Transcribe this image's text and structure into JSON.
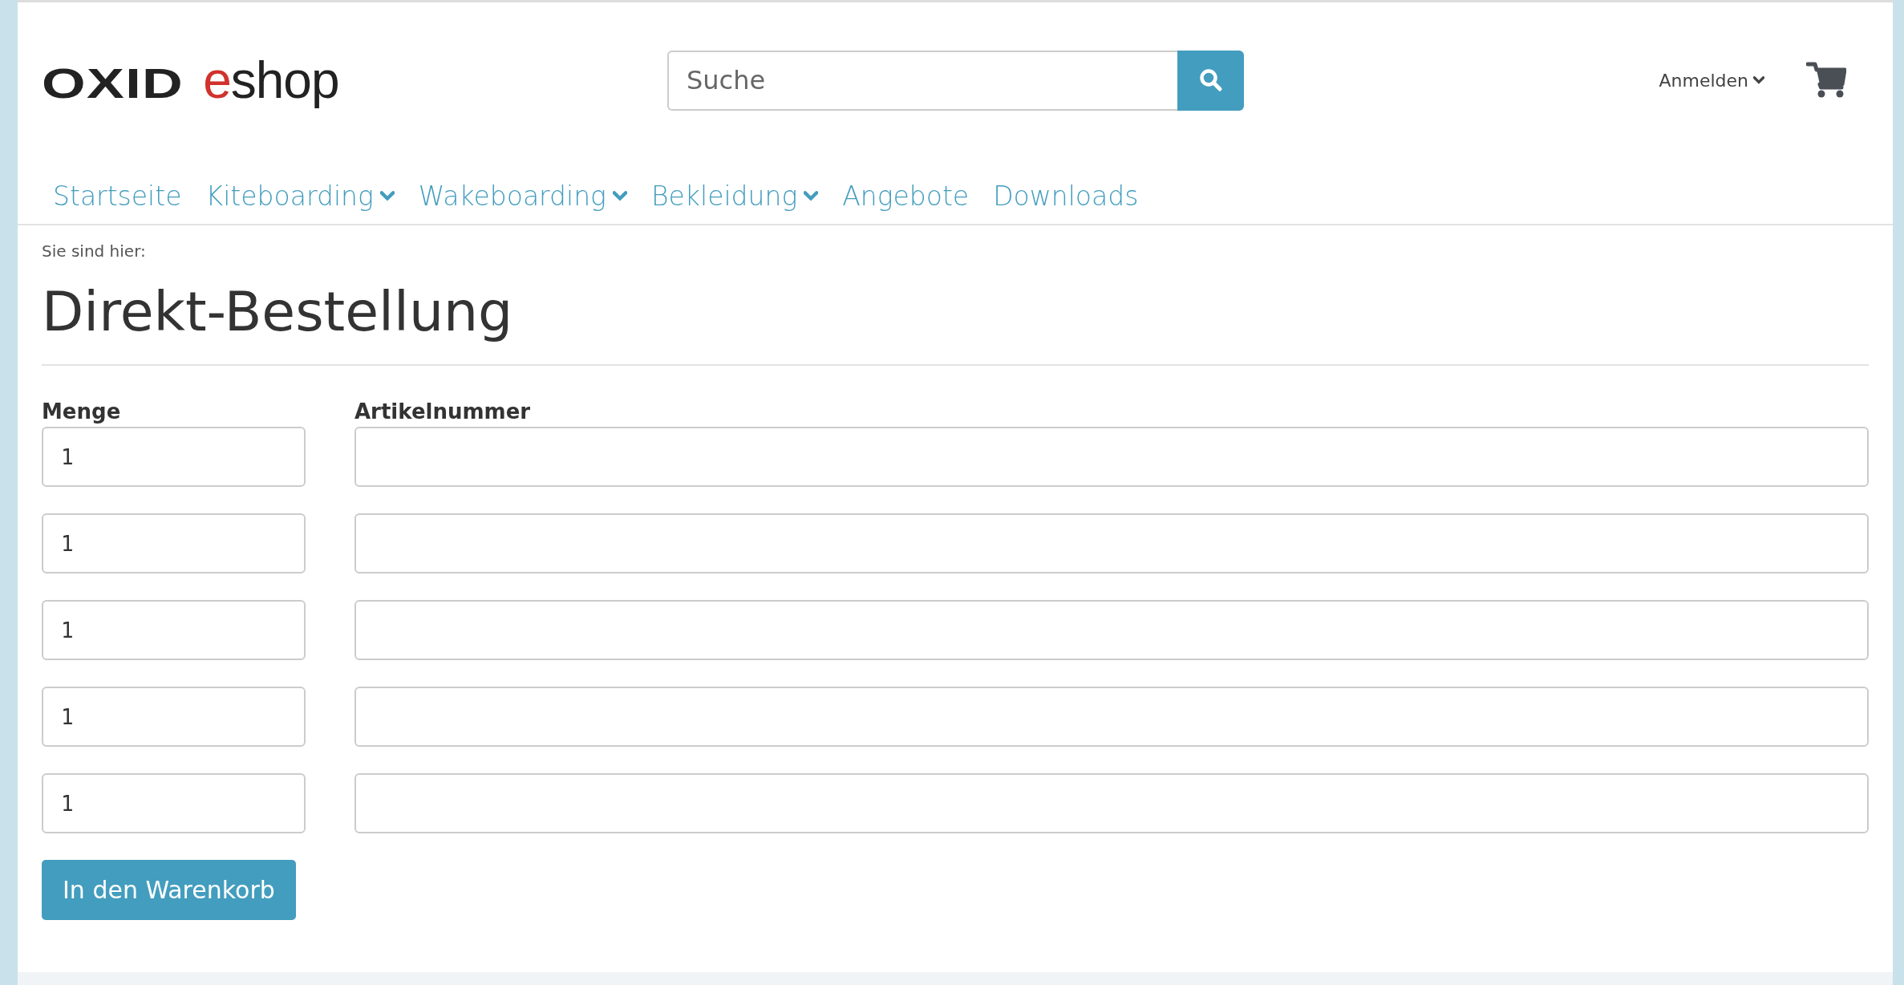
{
  "logo": {
    "brand": "OXID",
    "accent": "e",
    "product": "shop"
  },
  "search": {
    "placeholder": "Suche"
  },
  "account": {
    "label": "Anmelden",
    "has_dropdown": true
  },
  "nav": [
    {
      "label": "Startseite",
      "has_dropdown": false
    },
    {
      "label": "Kiteboarding",
      "has_dropdown": true
    },
    {
      "label": "Wakeboarding",
      "has_dropdown": true
    },
    {
      "label": "Bekleidung",
      "has_dropdown": true
    },
    {
      "label": "Angebote",
      "has_dropdown": false
    },
    {
      "label": "Downloads",
      "has_dropdown": false
    }
  ],
  "breadcrumb": "Sie sind hier:",
  "title": "Direkt-Bestellung",
  "form": {
    "quantity_label": "Menge",
    "article_label": "Artikelnummer",
    "rows": [
      {
        "quantity": "1"
      },
      {
        "quantity": "1"
      },
      {
        "quantity": "1"
      },
      {
        "quantity": "1"
      },
      {
        "quantity": "1"
      }
    ],
    "submit": "In den Warenkorb"
  }
}
